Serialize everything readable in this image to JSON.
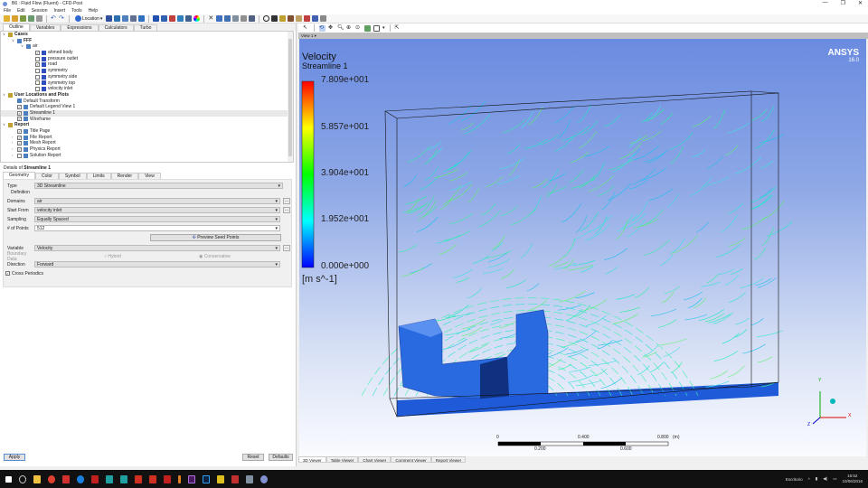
{
  "window": {
    "title": "B6 : Fluid Flow (Fluent) - CFD-Post",
    "controls": [
      "—",
      "❐",
      "✕"
    ]
  },
  "menu": [
    "File",
    "Edit",
    "Session",
    "Insert",
    "Tools",
    "Help"
  ],
  "toolbar": {
    "location_label": "Location"
  },
  "left_tabs": [
    "Outline",
    "Variables",
    "Expressions",
    "Calculators",
    "Turbo"
  ],
  "tree": [
    {
      "label": "Cases",
      "level": 0,
      "bold": true,
      "expand": "v",
      "check": null
    },
    {
      "label": "FFF",
      "level": 1,
      "bold": true,
      "expand": "v",
      "check": null
    },
    {
      "label": "air",
      "level": 2,
      "bold": false,
      "expand": "v",
      "check": null
    },
    {
      "label": "ahmed body",
      "level": 3,
      "check": true
    },
    {
      "label": "pressure outlet",
      "level": 3,
      "check": false
    },
    {
      "label": "road",
      "level": 3,
      "check": true
    },
    {
      "label": "symmetry",
      "level": 3,
      "check": false
    },
    {
      "label": "symmetry side",
      "level": 3,
      "check": false
    },
    {
      "label": "symmetry top",
      "level": 3,
      "check": false
    },
    {
      "label": "velocity inlet",
      "level": 3,
      "check": false
    },
    {
      "label": "User Locations and Plots",
      "level": 0,
      "bold": true,
      "expand": "v",
      "check": null
    },
    {
      "label": "Default Transform",
      "level": 1,
      "check": null
    },
    {
      "label": "Default Legend View 1",
      "level": 1,
      "check": true
    },
    {
      "label": "Streamline 1",
      "level": 1,
      "check": true,
      "selected": true
    },
    {
      "label": "Wireframe",
      "level": 1,
      "check": true
    },
    {
      "label": "Report",
      "level": 0,
      "bold": true,
      "expand": "v",
      "check": null
    },
    {
      "label": "Title Page",
      "level": 1,
      "check": true
    },
    {
      "label": "File Report",
      "level": 1,
      "check": true,
      "expand": ">"
    },
    {
      "label": "Mesh Report",
      "level": 1,
      "check": true,
      "expand": ">"
    },
    {
      "label": "Physics Report",
      "level": 1,
      "check": true,
      "expand": ">"
    },
    {
      "label": "Solution Report",
      "level": 1,
      "check": false,
      "expand": ">"
    }
  ],
  "details": {
    "title_prefix": "Details of ",
    "title_name": "Streamline 1",
    "tabs": [
      "Geometry",
      "Color",
      "Symbol",
      "Limits",
      "Render",
      "View"
    ],
    "type_label": "Type",
    "type_value": "3D Streamline",
    "definition_label": "Definition",
    "domains_label": "Domains",
    "domains_value": "air",
    "start_label": "Start From",
    "start_value": "velocity inlet",
    "sampling_label": "Sampling",
    "sampling_value": "Equally Spaced",
    "points_label": "# of Points",
    "points_value": "512",
    "preview_button": "Preview Seed Points",
    "variable_label": "Variable",
    "variable_value": "Velocity",
    "boundary_label": "Boundary Data",
    "hybrid_label": "Hybrid",
    "conservative_label": "Conservative",
    "direction_label": "Direction",
    "direction_value": "Forward",
    "cross_label": "Cross Periodics",
    "cross_checked": true,
    "apply": "Apply",
    "reset": "Reset",
    "defaults": "Defaults"
  },
  "viewer": {
    "view_tab": "View 1 ▾",
    "legend_title": "Velocity",
    "legend_subtitle": "Streamline 1",
    "legend_values": [
      "7.809e+001",
      "5.857e+001",
      "3.904e+001",
      "1.952e+001",
      "0.000e+000"
    ],
    "legend_units": "[m s^-1]",
    "brand": "ANSYS",
    "version": "16.0",
    "scale_top": [
      "0",
      "0.400",
      "0.800",
      "(m)"
    ],
    "scale_bottom": [
      "0.200",
      "0.600"
    ],
    "axes": {
      "x": "X",
      "y": "Y",
      "z": "Z"
    },
    "streamline_color": "#20e8c8",
    "bottom_tabs": [
      "3D Viewer",
      "Table Viewer",
      "Chart Viewer",
      "Comment Viewer",
      "Report Viewer"
    ]
  },
  "taskbar": {
    "lang": "Escritorio",
    "time": "16:52",
    "date": "10/06/2016"
  }
}
